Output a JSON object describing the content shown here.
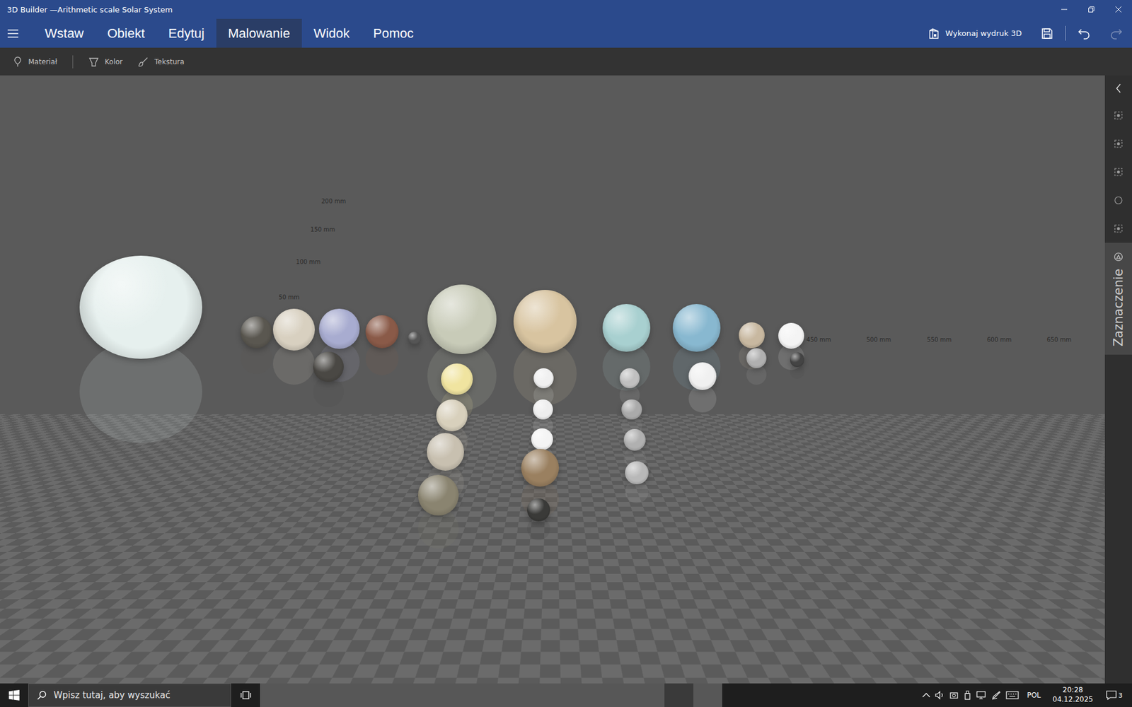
{
  "window": {
    "title": "3D Builder —Arithmetic scale Solar System"
  },
  "menu": {
    "tabs": [
      {
        "label": "Wstaw",
        "selected": false
      },
      {
        "label": "Obiekt",
        "selected": false
      },
      {
        "label": "Edytuj",
        "selected": false
      },
      {
        "label": "Malowanie",
        "selected": true
      },
      {
        "label": "Widok",
        "selected": false
      },
      {
        "label": "Pomoc",
        "selected": false
      }
    ],
    "print_label": "Wykonaj wydruk 3D",
    "undo": {
      "disabled": false
    },
    "redo": {
      "disabled": true
    }
  },
  "toolbar": {
    "items": [
      {
        "label": "Materiał"
      },
      {
        "label": "Kolor"
      },
      {
        "label": "Tekstura"
      }
    ]
  },
  "canvas": {
    "scale_labels": [
      "50 mm",
      "100 mm",
      "150 mm",
      "200 mm",
      "450 mm",
      "500 mm",
      "550 mm",
      "600 mm",
      "650 mm"
    ],
    "spheres": [
      {
        "color": "#e6f0ee"
      },
      {
        "color": "#5a5750"
      },
      {
        "color": "#d8d0c0"
      },
      {
        "color": "#a8acd0"
      },
      {
        "color": "#8a5a48"
      },
      {
        "color": "#555555"
      },
      {
        "color": "#4a4844"
      },
      {
        "color": "#c8cbb8"
      },
      {
        "color": "#f0e4a0"
      },
      {
        "color": "#d8d0bc"
      },
      {
        "color": "#c8c0b0"
      },
      {
        "color": "#8a8470"
      },
      {
        "color": "#d8c4a0"
      },
      {
        "color": "#f0f0f0"
      },
      {
        "color": "#eeeeee"
      },
      {
        "color": "#f4f4f4"
      },
      {
        "color": "#9a8060"
      },
      {
        "color": "#3a3a38"
      },
      {
        "color": "#a8d0d0"
      },
      {
        "color": "#c0c0c0"
      },
      {
        "color": "#aaaaaa"
      },
      {
        "color": "#b0b0b0"
      },
      {
        "color": "#b8b8b8"
      },
      {
        "color": "#88b8d0"
      },
      {
        "color": "#f0f0f0"
      },
      {
        "color": "#c8b8a0"
      },
      {
        "color": "#f4f4f4"
      },
      {
        "color": "#b0b0b0"
      },
      {
        "color": "#444444"
      }
    ]
  },
  "sidebar": {
    "tools": [
      {
        "selected": false
      },
      {
        "selected": false
      },
      {
        "selected": false
      },
      {
        "selected": false
      },
      {
        "selected": false
      },
      {
        "selected": true,
        "label": "Zaznaczenie"
      }
    ]
  },
  "taskbar": {
    "search_placeholder": "Wpisz tutaj, aby wyszukać",
    "apps": [
      {
        "running": true,
        "active": false
      },
      {
        "running": true,
        "active": false
      },
      {
        "running": true,
        "active": false
      },
      {
        "running": false,
        "active": false
      },
      {
        "running": true,
        "active": false
      },
      {
        "running": true,
        "active": false
      },
      {
        "running": true,
        "active": false
      },
      {
        "running": false,
        "active": false
      },
      {
        "running": false,
        "active": false
      },
      {
        "running": false,
        "active": false
      },
      {
        "running": true,
        "active": false
      },
      {
        "running": true,
        "active": false
      },
      {
        "running": false,
        "active": false
      },
      {
        "running": false,
        "active": false
      },
      {
        "running": true,
        "active": true
      },
      {
        "running": true,
        "active": false
      }
    ],
    "tray": {
      "language": "POL",
      "time": "20:28",
      "date": "04.12.2025",
      "notifications": "3"
    }
  }
}
